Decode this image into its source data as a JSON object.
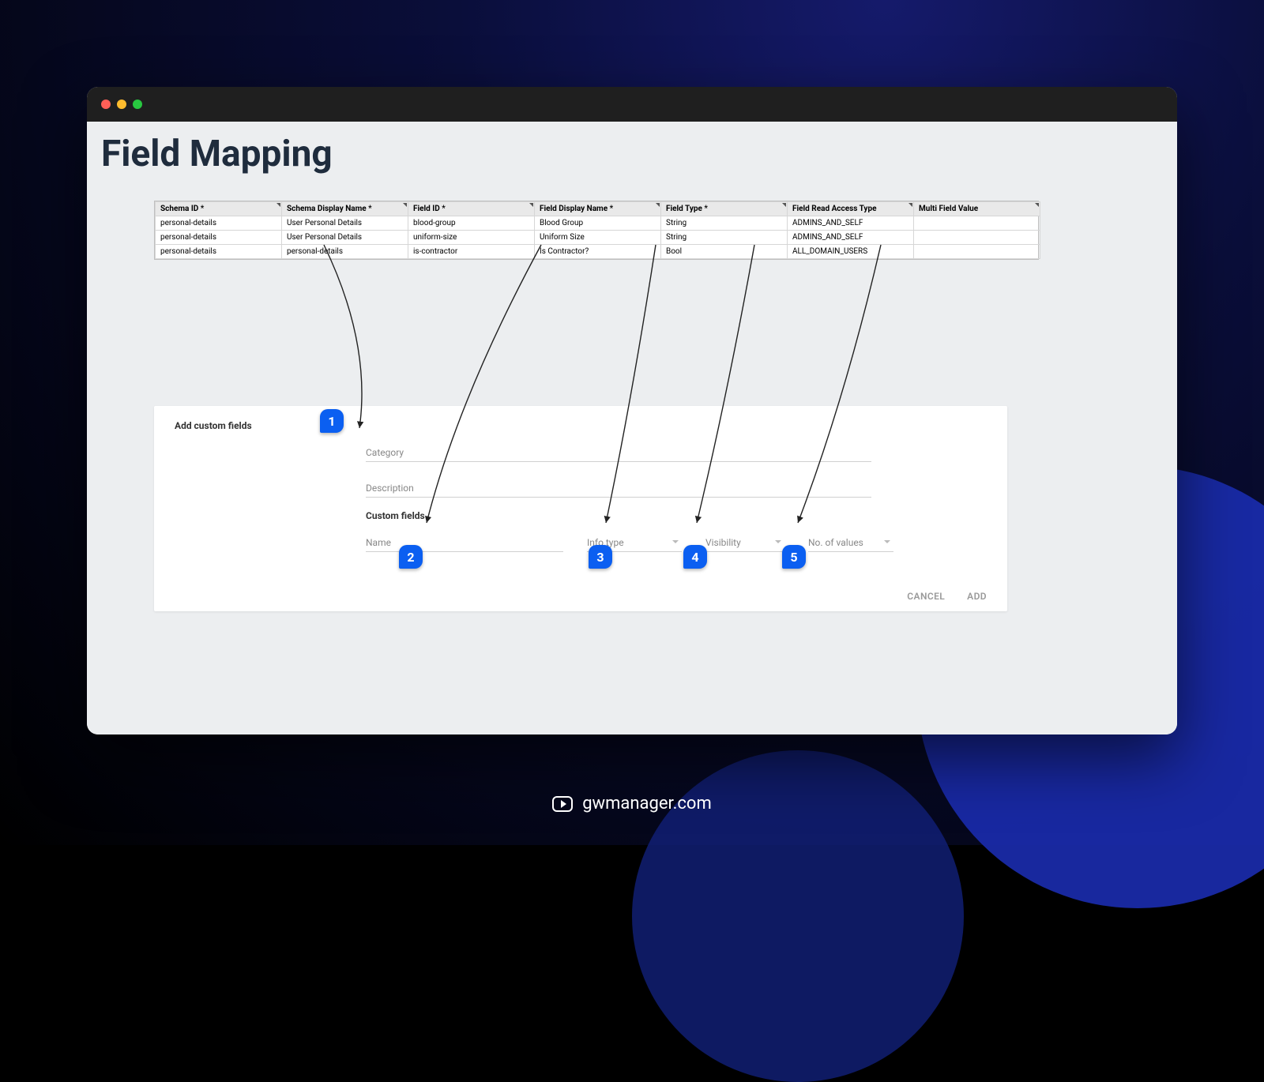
{
  "brand": "gwmanager.com",
  "page": {
    "title": "Field Mapping"
  },
  "window": {
    "dots": [
      "red",
      "yellow",
      "green"
    ]
  },
  "table": {
    "headers": [
      "Schema ID *",
      "Schema Display Name *",
      "Field ID *",
      "Field Display Name *",
      "Field Type *",
      "Field Read Access Type",
      "Multi Field Value"
    ],
    "rows": [
      [
        "personal-details",
        "User Personal Details",
        "blood-group",
        "Blood Group",
        "String",
        "ADMINS_AND_SELF",
        ""
      ],
      [
        "personal-details",
        "User Personal Details",
        "uniform-size",
        "Uniform Size",
        "String",
        "ADMINS_AND_SELF",
        ""
      ],
      [
        "personal-details",
        "personal-details",
        "is-contractor",
        "Is Contractor?",
        "Bool",
        "ALL_DOMAIN_USERS",
        ""
      ]
    ]
  },
  "panel": {
    "title": "Add custom fields",
    "category_label": "Category",
    "description_label": "Description",
    "custom_fields_label": "Custom fields",
    "name_label": "Name",
    "info_type_label": "Info type",
    "visibility_label": "Visibility",
    "no_of_values_label": "No. of values",
    "cancel": "CANCEL",
    "add": "ADD"
  },
  "badges": {
    "b1": "1",
    "b2": "2",
    "b3": "3",
    "b4": "4",
    "b5": "5"
  }
}
